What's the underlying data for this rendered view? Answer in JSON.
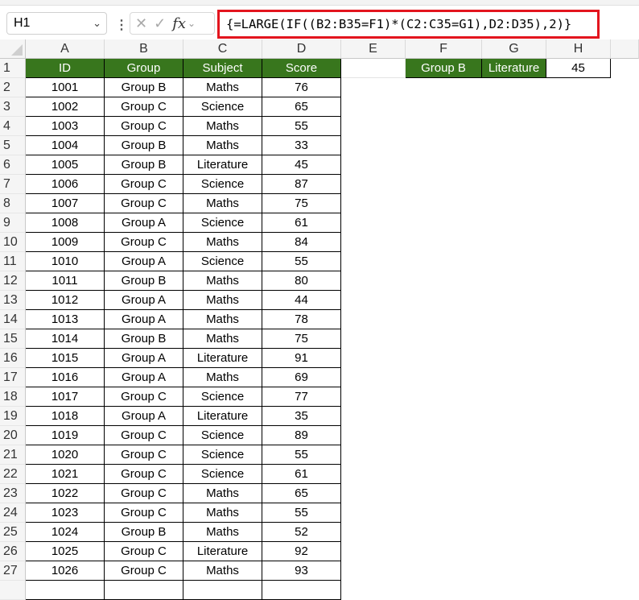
{
  "formula_bar": {
    "name_box": "H1",
    "formula": "{=LARGE(IF((B2:B35=F1)*(C2:C35=G1),D2:D35),2)}",
    "icons": [
      "chevron-down-icon",
      "more-options-icon",
      "cancel-icon",
      "enter-icon",
      "function-icon"
    ]
  },
  "columns": [
    "A",
    "B",
    "C",
    "D",
    "E",
    "F",
    "G",
    "H"
  ],
  "table": {
    "headers": [
      "ID",
      "Group",
      "Subject",
      "Score"
    ],
    "rows": [
      [
        "1001",
        "Group B",
        "Maths",
        "76"
      ],
      [
        "1002",
        "Group C",
        "Science",
        "65"
      ],
      [
        "1003",
        "Group C",
        "Maths",
        "55"
      ],
      [
        "1004",
        "Group B",
        "Maths",
        "33"
      ],
      [
        "1005",
        "Group B",
        "Literature",
        "45"
      ],
      [
        "1006",
        "Group C",
        "Science",
        "87"
      ],
      [
        "1007",
        "Group C",
        "Maths",
        "75"
      ],
      [
        "1008",
        "Group A",
        "Science",
        "61"
      ],
      [
        "1009",
        "Group C",
        "Maths",
        "84"
      ],
      [
        "1010",
        "Group A",
        "Science",
        "55"
      ],
      [
        "1011",
        "Group B",
        "Maths",
        "80"
      ],
      [
        "1012",
        "Group A",
        "Maths",
        "44"
      ],
      [
        "1013",
        "Group A",
        "Maths",
        "78"
      ],
      [
        "1014",
        "Group B",
        "Maths",
        "75"
      ],
      [
        "1015",
        "Group A",
        "Literature",
        "91"
      ],
      [
        "1016",
        "Group A",
        "Maths",
        "69"
      ],
      [
        "1017",
        "Group C",
        "Science",
        "77"
      ],
      [
        "1018",
        "Group A",
        "Literature",
        "35"
      ],
      [
        "1019",
        "Group C",
        "Science",
        "89"
      ],
      [
        "1020",
        "Group C",
        "Science",
        "55"
      ],
      [
        "1021",
        "Group C",
        "Science",
        "61"
      ],
      [
        "1022",
        "Group C",
        "Maths",
        "65"
      ],
      [
        "1023",
        "Group C",
        "Maths",
        "55"
      ],
      [
        "1024",
        "Group B",
        "Maths",
        "52"
      ],
      [
        "1025",
        "Group C",
        "Literature",
        "92"
      ],
      [
        "1026",
        "Group C",
        "Maths",
        "93"
      ]
    ]
  },
  "criteria": {
    "group": "Group B",
    "subject": "Literature",
    "result": "45"
  },
  "colors": {
    "header_fill": "#38761d",
    "formula_highlight": "#e3151e"
  }
}
